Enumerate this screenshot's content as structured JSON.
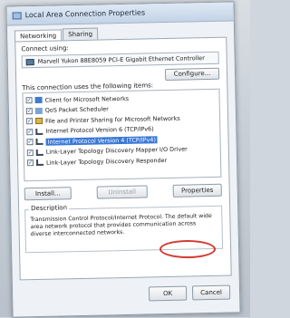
{
  "window": {
    "title": "Local Area Connection Properties"
  },
  "tabs": [
    {
      "label": "Networking"
    },
    {
      "label": "Sharing"
    }
  ],
  "connect_using": {
    "label": "Connect using:",
    "adapter": "Marvell Yukon 88E8059 PCI-E Gigabit Ethernet Controller",
    "configure_button": "Configure..."
  },
  "items_header": "This connection uses the following items:",
  "items": [
    {
      "label": "Client for Microsoft Networks",
      "checked": true,
      "icon": "client-icon"
    },
    {
      "label": "QoS Packet Scheduler",
      "checked": true,
      "icon": "qos-icon"
    },
    {
      "label": "File and Printer Sharing for Microsoft Networks",
      "checked": true,
      "icon": "share-icon"
    },
    {
      "label": "Internet Protocol Version 6 (TCP/IPv6)",
      "checked": true,
      "icon": "protocol-icon"
    },
    {
      "label": "Internet Protocol Version 4 (TCP/IPv4)",
      "checked": true,
      "icon": "protocol-icon",
      "selected": true
    },
    {
      "label": "Link-Layer Topology Discovery Mapper I/O Driver",
      "checked": true,
      "icon": "protocol-icon"
    },
    {
      "label": "Link-Layer Topology Discovery Responder",
      "checked": true,
      "icon": "protocol-icon"
    }
  ],
  "buttons": {
    "install": "Install...",
    "uninstall": "Uninstall",
    "properties": "Properties",
    "ok": "OK",
    "cancel": "Cancel"
  },
  "description": {
    "title": "Description",
    "text": "Transmission Control Protocol/Internet Protocol. The default wide area network protocol that provides communication across diverse interconnected networks."
  },
  "colors": {
    "highlight": "#3a78d6",
    "annotation_circle": "#d23a2f"
  }
}
